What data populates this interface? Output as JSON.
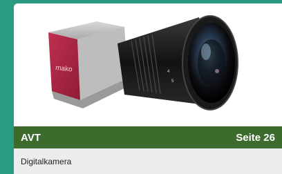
{
  "card": {
    "image": {
      "subject": "camera-photo",
      "logo_text": "mako"
    },
    "banner": {
      "brand": "AVT",
      "page": "Seite 26"
    },
    "caption": "Digitalkamera"
  },
  "colors": {
    "background": "#2a9a80",
    "banner": "#3d6b2e",
    "caption_bg": "#ececec",
    "camera_body": "#b8284a"
  }
}
